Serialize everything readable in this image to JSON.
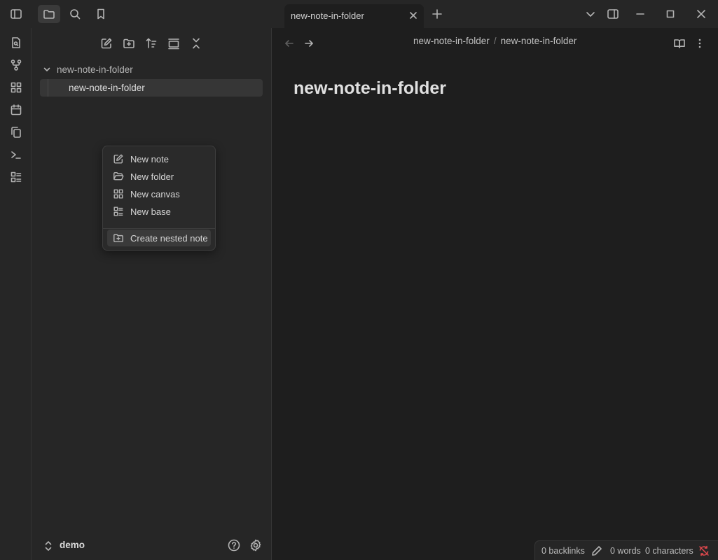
{
  "tab": {
    "title": "new-note-in-folder"
  },
  "file_tree": {
    "folder": "new-note-in-folder",
    "file": "new-note-in-folder"
  },
  "vault": {
    "name": "demo"
  },
  "context_menu": {
    "items": [
      {
        "label": "New note",
        "icon": "edit-icon"
      },
      {
        "label": "New folder",
        "icon": "folder-open-icon"
      },
      {
        "label": "New canvas",
        "icon": "canvas-icon"
      },
      {
        "label": "New base",
        "icon": "base-icon"
      }
    ],
    "nested": {
      "label": "Create nested note",
      "icon": "folder-plus-icon"
    }
  },
  "breadcrumb": {
    "parent": "new-note-in-folder",
    "separator": "/",
    "current": "new-note-in-folder"
  },
  "note": {
    "title": "new-note-in-folder"
  },
  "status": {
    "backlinks": "0 backlinks",
    "words": "0 words",
    "characters": "0 characters"
  },
  "colors": {
    "background": "#1e1e1e",
    "sidebar": "#262626",
    "sync_error": "#e0484d"
  }
}
